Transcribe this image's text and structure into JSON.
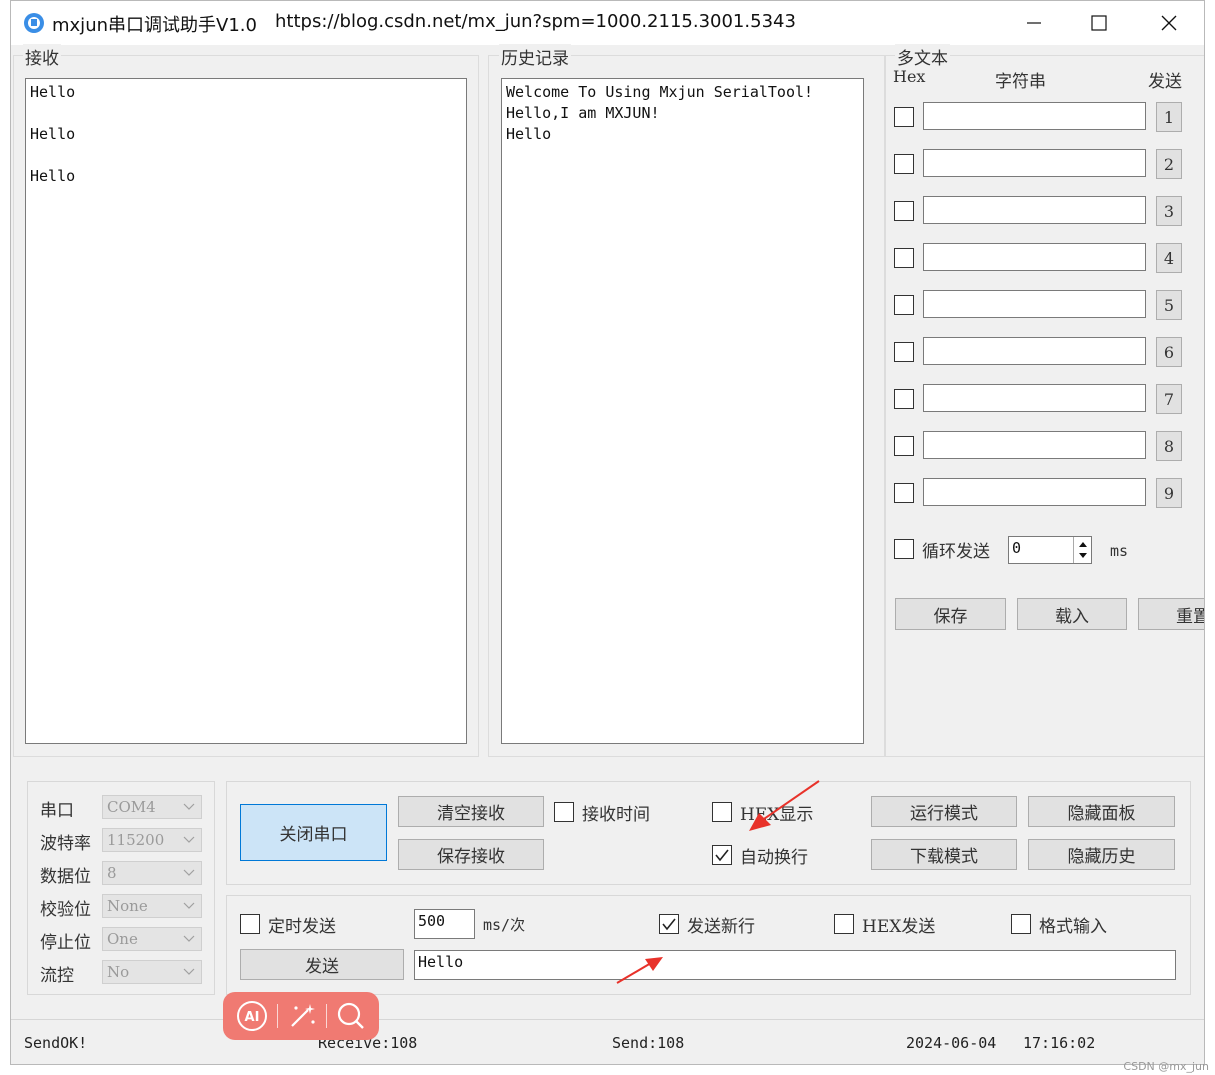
{
  "titlebar": {
    "title": "mxjun串口调试助手V1.0",
    "url": "https://blog.csdn.net/mx_jun?spm=1000.2115.3001.5343"
  },
  "receive": {
    "label": "接收",
    "text": "Hello\n\nHello\n\nHello"
  },
  "history": {
    "label": "历史记录",
    "text": "Welcome To Using Mxjun SerialTool!\nHello,I am MXJUN!\nHello"
  },
  "multi": {
    "label": "多文本",
    "col_hex": "Hex",
    "col_string": "字符串",
    "col_send": "发送",
    "rows": [
      {
        "num": "1",
        "value": ""
      },
      {
        "num": "2",
        "value": ""
      },
      {
        "num": "3",
        "value": ""
      },
      {
        "num": "4",
        "value": ""
      },
      {
        "num": "5",
        "value": ""
      },
      {
        "num": "6",
        "value": ""
      },
      {
        "num": "7",
        "value": ""
      },
      {
        "num": "8",
        "value": ""
      },
      {
        "num": "9",
        "value": ""
      }
    ],
    "loop_label": "循环发送",
    "loop_value": "0",
    "loop_unit": "ms",
    "save_label": "保存",
    "load_label": "载入",
    "reset_label": "重置"
  },
  "port": {
    "port_label": "串口",
    "port_value": "COM4",
    "baud_label": "波特率",
    "baud_value": "115200",
    "data_label": "数据位",
    "data_value": "8",
    "parity_label": "校验位",
    "parity_value": "None",
    "stop_label": "停止位",
    "stop_value": "One",
    "flow_label": "流控",
    "flow_value": "No"
  },
  "controls": {
    "close_port": "关闭串口",
    "clear_receive": "清空接收",
    "save_receive": "保存接收",
    "receive_time": "接收时间",
    "hex_display": "HEX显示",
    "auto_wrap": "自动换行",
    "run_mode": "运行模式",
    "download_mode": "下载模式",
    "hide_panel": "隐藏面板",
    "hide_history": "隐藏历史"
  },
  "send": {
    "timed_send": "定时发送",
    "interval_value": "500",
    "interval_unit": "ms/次",
    "send_newline": "发送新行",
    "hex_send": "HEX发送",
    "format_input": "格式输入",
    "send_button": "发送",
    "send_text": "Hello"
  },
  "status": {
    "message": "SendOK!",
    "receive": "Receive:108",
    "send": "Send:108",
    "date": "2024-06-04",
    "time": "17:16:02"
  },
  "floatbar": {
    "ai_label": "AI"
  },
  "watermark": "CSDN @mx_jun",
  "colors": {
    "primary_button": "#cce4f7",
    "annotation_arrow": "#e8322a",
    "float_bar": "#f07a72"
  }
}
